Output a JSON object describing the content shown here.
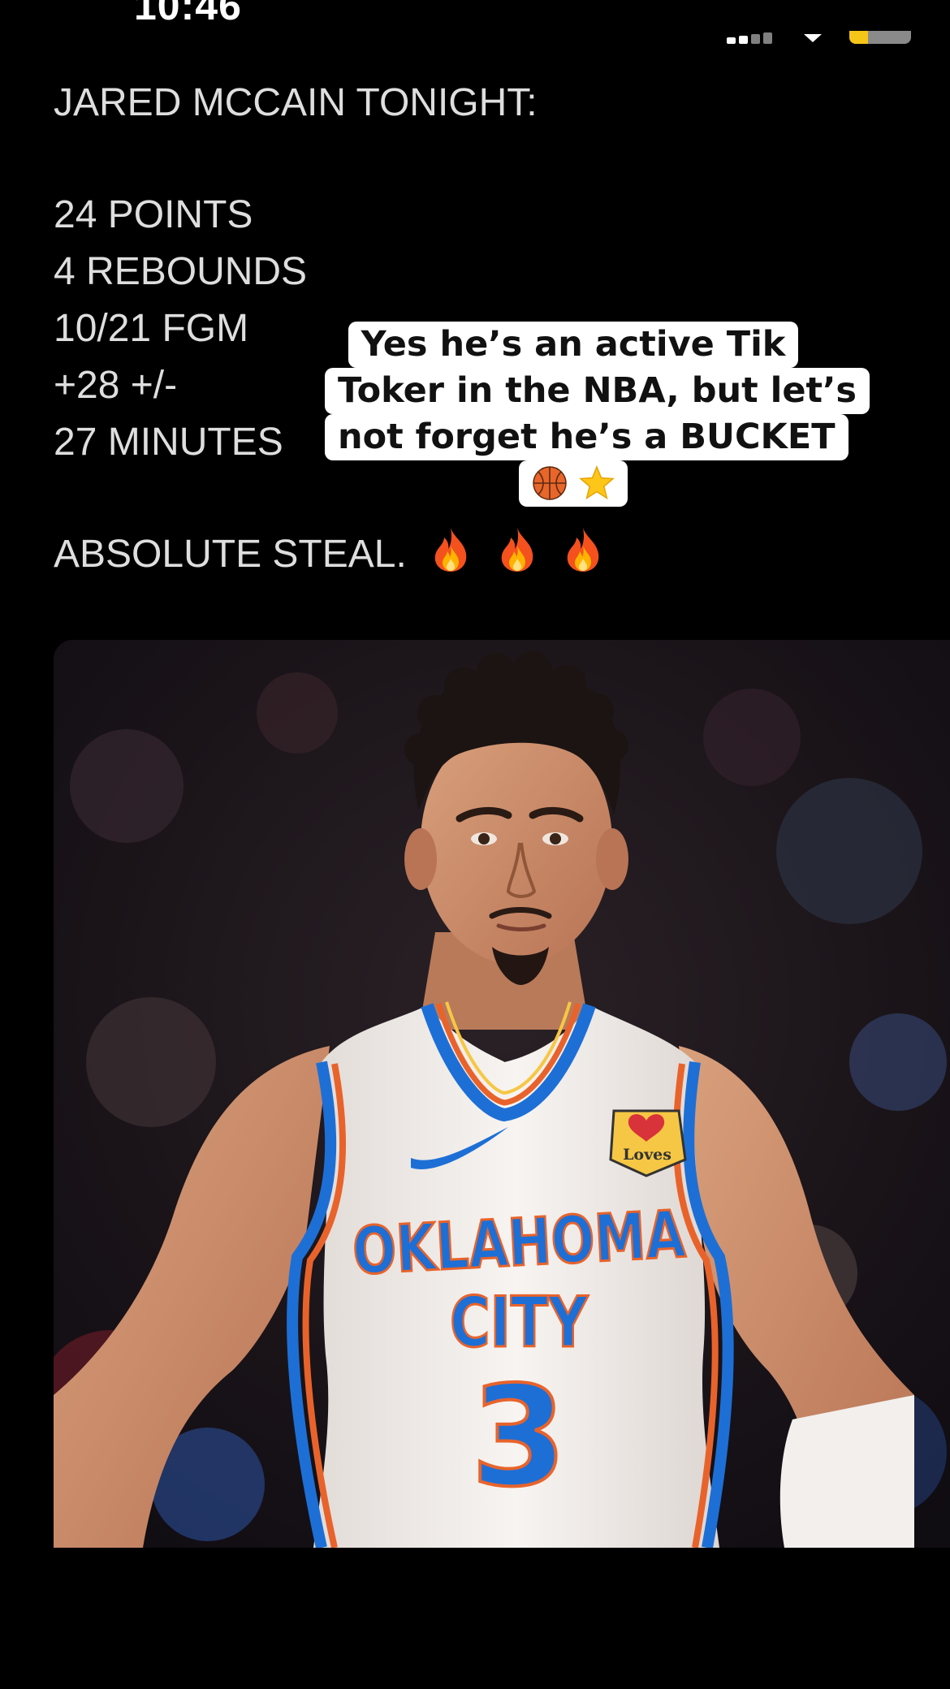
{
  "status_bar": {
    "time": "10:46"
  },
  "post": {
    "title": "JARED MCCAIN TONIGHT:",
    "stats": [
      "24 POINTS",
      "4 REBOUNDS",
      "10/21 FGM",
      "+28 +/-",
      "27 MINUTES"
    ],
    "closing": "ABSOLUTE STEAL.",
    "closing_emojis": [
      "fire-icon",
      "fire-icon",
      "fire-icon"
    ]
  },
  "caption": {
    "lines": [
      "Yes he’s an active Tik",
      "Toker in the NBA, but let’s",
      "not forget he’s a BUCKET"
    ],
    "emojis": [
      "basketball-icon",
      "star-icon"
    ]
  },
  "photo": {
    "jersey_sponsor": "Loves",
    "jersey_text_top": "OKLAHOMA",
    "jersey_text_bottom": "CITY",
    "jersey_number": "3",
    "colors": {
      "background_dark": "#1b1520",
      "jersey": "#f4f1ee",
      "blue": "#1d6fd6",
      "orange": "#e8632b",
      "skin": "#c98b68"
    }
  }
}
